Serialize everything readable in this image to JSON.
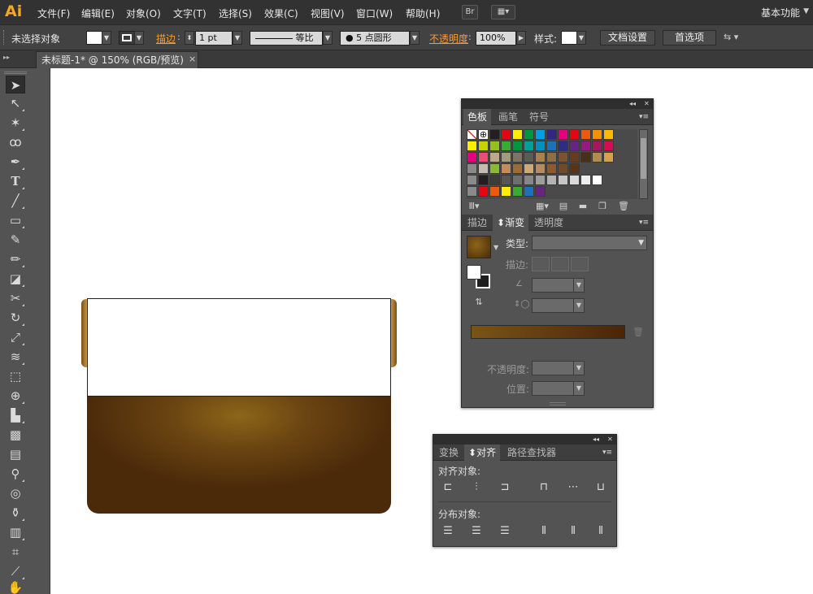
{
  "app": {
    "logo": "Ai",
    "workspace": "基本功能"
  },
  "menu": [
    "文件(F)",
    "编辑(E)",
    "对象(O)",
    "文字(T)",
    "选择(S)",
    "效果(C)",
    "视图(V)",
    "窗口(W)",
    "帮助(H)"
  ],
  "menu_buttons": {
    "bridge": "Br"
  },
  "control": {
    "selection": "未选择对象",
    "stroke_label": "描边",
    "stroke_weight": "1 pt",
    "profile": "等比",
    "brush": "5 点圆形",
    "opacity_label": "不透明度",
    "opacity_value": "100%",
    "style_label": "样式:",
    "doc_setup": "文档设置",
    "preferences": "首选项"
  },
  "document": {
    "tab_title": "未标题-1* @ 150% (RGB/预览)",
    "close": "×"
  },
  "swatches_panel": {
    "tabs": [
      "色板",
      "画笔",
      "符号"
    ],
    "row1": [
      "#ffffff",
      "#ffffff",
      "#231f20",
      "#e30613",
      "#ffed00",
      "#00963f",
      "#009fe3",
      "#312783",
      "#e6007e",
      "#e30613",
      "#ea5b0c",
      "#f39200",
      "#fbba00"
    ],
    "row2": [
      "#ffed00",
      "#c7d300",
      "#95c11f",
      "#3aaa35",
      "#009640",
      "#00a19a",
      "#0090c0",
      "#1d71b8",
      "#2d2e83",
      "#662483",
      "#951b81",
      "#a3195b",
      "#d60b51"
    ],
    "row3": [
      "#e6007e",
      "#e94e77",
      "#bea88c",
      "#a39b7d",
      "#7c7464",
      "#5e5a55",
      "#a8814c",
      "#906e45",
      "#7c5230",
      "#653c1c",
      "#483016",
      "#b08c4f",
      "#d5a24b"
    ],
    "row4": [
      "#c4bcaf",
      "#8db836",
      "#c58b5b",
      "#9a6c38",
      "#cda977",
      "#b58c5f",
      "#8e5a2d",
      "#714a27",
      "#5a3515"
    ],
    "row5": [
      "#231f20",
      "#3c3c3b",
      "#575756",
      "#706f6f",
      "#878787",
      "#9d9d9c",
      "#b2b2b2",
      "#c6c6c6",
      "#dadada",
      "#ededed",
      "#ffffff"
    ],
    "row6": [
      "#e30613",
      "#ea5b0c",
      "#ffed00",
      "#3aaa35",
      "#1d71b8",
      "#662483"
    ]
  },
  "gradient_panel": {
    "tabs": [
      "描边",
      "渐变",
      "透明度"
    ],
    "type_label": "类型:",
    "stroke_label": "描边:",
    "opacity_label": "不透明度:",
    "location_label": "位置:"
  },
  "align_panel": {
    "tabs": [
      "变换",
      "对齐",
      "路径查找器"
    ],
    "align_objects": "对齐对象:",
    "distribute_objects": "分布对象:"
  },
  "colors": {
    "accent_orange": "#f39c3c",
    "gradient_start": "#7a5416",
    "gradient_end": "#4a2508"
  }
}
